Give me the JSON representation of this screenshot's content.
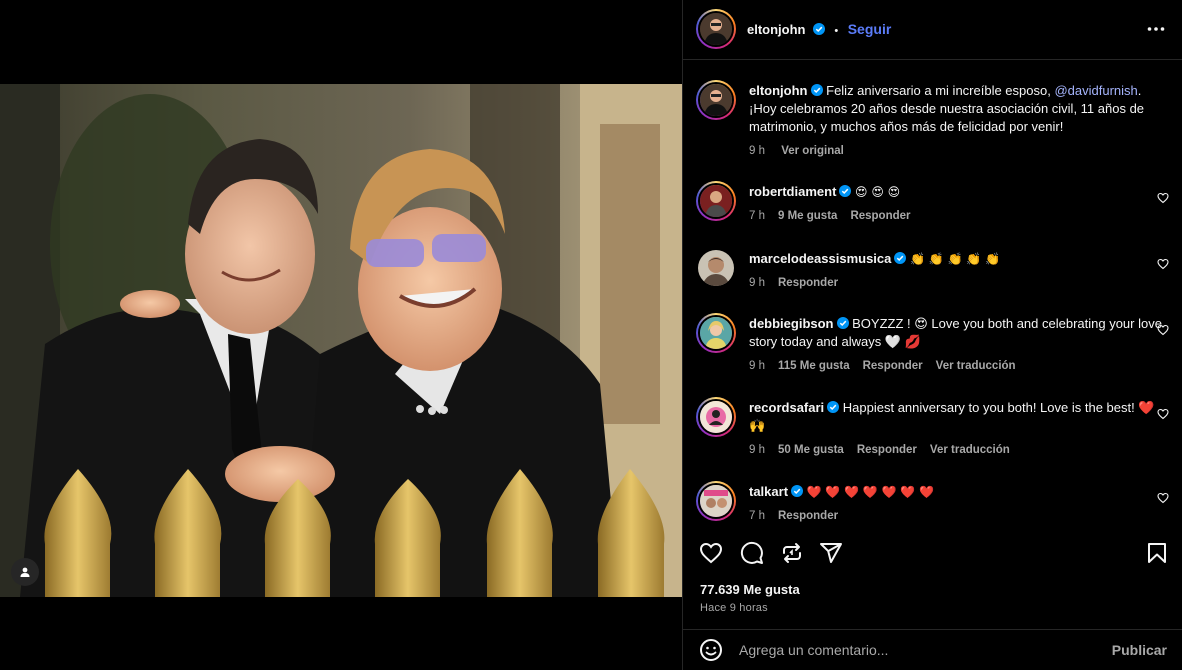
{
  "post": {
    "author": "eltonjohn",
    "follow_label": "Seguir",
    "separator": "•",
    "caption_author": "eltonjohn",
    "caption_part1": "Feliz aniversario a mi increíble esposo, ",
    "caption_mention": "@davidfurnish",
    "caption_part2": ". ¡Hoy celebramos 20 años desde nuestra asociación civil, 11 años de matrimonio, y muchos años más de felicidad por venir!",
    "caption_time": "9 h",
    "caption_link": "Ver original",
    "likes": "77.639 Me gusta",
    "posted": "Hace 9 horas",
    "comment_placeholder": "Agrega un comentario...",
    "publish_label": "Publicar"
  },
  "comments": [
    {
      "user": "robertdiament",
      "text": "😍 😍 😍",
      "time": "7 h",
      "likes": "9 Me gusta",
      "reply": "Responder"
    },
    {
      "user": "marcelodeassismusica",
      "text": "👏 👏 👏 👏 👏",
      "time": "9 h",
      "reply": "Responder"
    },
    {
      "user": "debbiegibson",
      "text": "BOYZZZ ! 😍 Love you both and celebrating your love story today and always 🤍 💋",
      "time": "9 h",
      "likes": "115 Me gusta",
      "reply": "Responder",
      "translate": "Ver traducción"
    },
    {
      "user": "recordsafari",
      "text": "Happiest anniversary to you both! Love is the best! ❤️ 🙌",
      "time": "9 h",
      "likes": "50 Me gusta",
      "reply": "Responder",
      "translate": "Ver traducción"
    },
    {
      "user": "talkart",
      "text": "❤️ ❤️ ❤️ ❤️ ❤️ ❤️ ❤️",
      "time": "7 h",
      "reply": "Responder"
    }
  ],
  "colors": {
    "accent": "#5b7cf8",
    "verified": "#0095f6",
    "background": "#000000",
    "muted": "#a8a8a8",
    "mention": "#a5b4fc"
  },
  "icons": [
    "more-icon",
    "like-icon",
    "comment-icon",
    "repost-icon",
    "share-icon",
    "save-icon",
    "emoji-icon",
    "user-tag-icon",
    "verified-badge-icon"
  ]
}
